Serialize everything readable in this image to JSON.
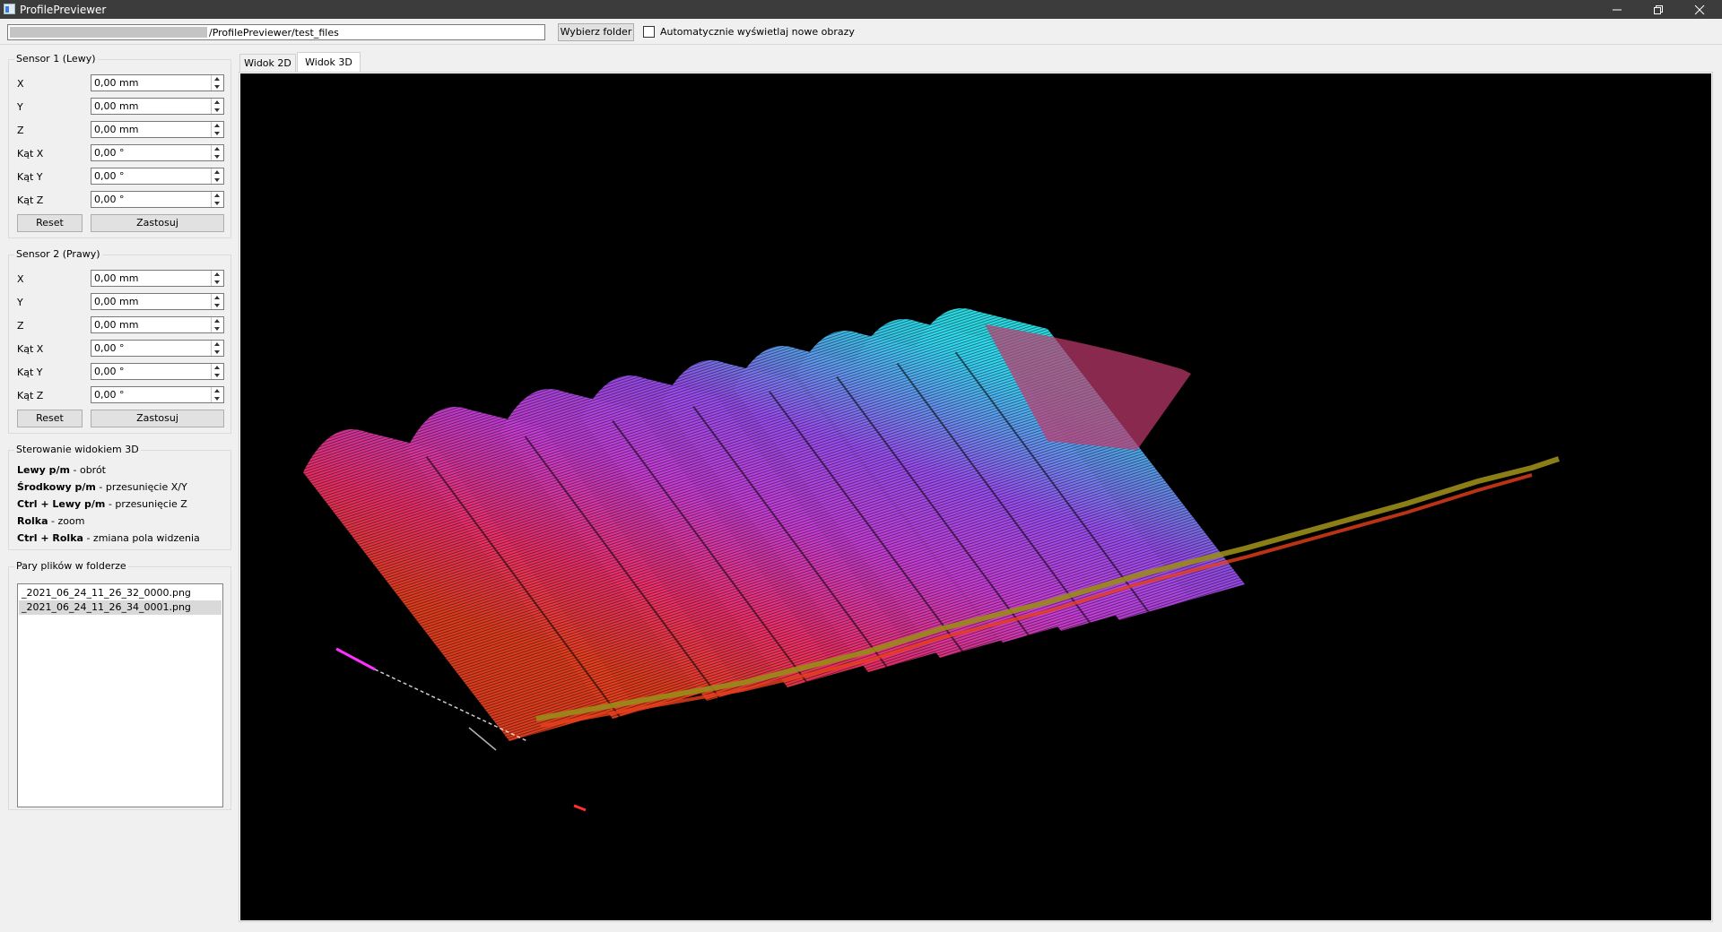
{
  "window": {
    "title": "ProfilePreviewer"
  },
  "toolbar": {
    "path_value": "/ProfilePreviewer/test_files",
    "select_folder_label": "Wybierz folder",
    "auto_show_label": "Automatycznie wyświetlaj nowe obrazy",
    "auto_show_checked": false
  },
  "sensor1": {
    "title": "Sensor 1 (Lewy)",
    "fields": [
      {
        "label": "X",
        "value": "0,00 mm"
      },
      {
        "label": "Y",
        "value": "0,00 mm"
      },
      {
        "label": "Z",
        "value": "0,00 mm"
      },
      {
        "label": "Kąt X",
        "value": "0,00 °"
      },
      {
        "label": "Kąt Y",
        "value": "0,00 °"
      },
      {
        "label": "Kąt Z",
        "value": "0,00 °"
      }
    ],
    "reset_label": "Reset",
    "apply_label": "Zastosuj"
  },
  "sensor2": {
    "title": "Sensor 2 (Prawy)",
    "fields": [
      {
        "label": "X",
        "value": "0,00 mm"
      },
      {
        "label": "Y",
        "value": "0,00 mm"
      },
      {
        "label": "Z",
        "value": "0,00 mm"
      },
      {
        "label": "Kąt X",
        "value": "0,00 °"
      },
      {
        "label": "Kąt Y",
        "value": "0,00 °"
      },
      {
        "label": "Kąt Z",
        "value": "0,00 °"
      }
    ],
    "reset_label": "Reset",
    "apply_label": "Zastosuj"
  },
  "controls": {
    "title": "Sterowanie widokiem 3D",
    "lines": [
      {
        "key": "Lewy p/m",
        "desc": " - obrót"
      },
      {
        "key": "Środkowy p/m",
        "desc": " - przesunięcie X/Y"
      },
      {
        "key": "Ctrl + Lewy p/m",
        "desc": " - przesunięcie Z"
      },
      {
        "key": "Rolka",
        "desc": " - zoom"
      },
      {
        "key": "Ctrl + Rolka",
        "desc": " - zmiana pola widzenia"
      }
    ]
  },
  "files": {
    "title": "Pary plików w folderze",
    "items": [
      {
        "name": "_2021_06_24_11_26_32_0000.png",
        "selected": false
      },
      {
        "name": "_2021_06_24_11_26_34_0001.png",
        "selected": true
      }
    ]
  },
  "tabs": [
    {
      "label": "Widok 2D",
      "active": false
    },
    {
      "label": "Widok 3D",
      "active": true
    }
  ],
  "colors": {
    "titlebar": "#3c3c3c",
    "view_background": "#000000",
    "ridge_top": "#2ee6f0",
    "mid": "#b048e8",
    "lower": "#f02a6e",
    "front_edge": "#a08a18"
  }
}
